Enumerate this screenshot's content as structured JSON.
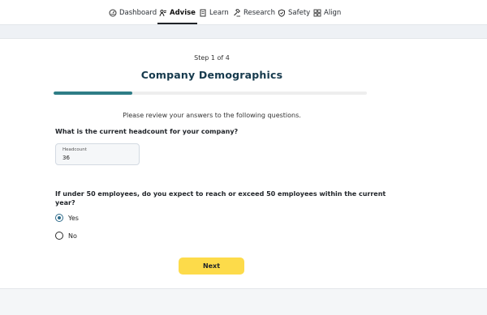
{
  "nav": {
    "items": [
      {
        "label": "Dashboard",
        "icon": "dashboard-icon",
        "active": false
      },
      {
        "label": "Advise",
        "icon": "advise-icon",
        "active": true
      },
      {
        "label": "Learn",
        "icon": "book-icon",
        "active": false
      },
      {
        "label": "Research",
        "icon": "gavel-icon",
        "active": false
      },
      {
        "label": "Safety",
        "icon": "shield-icon",
        "active": false
      },
      {
        "label": "Align",
        "icon": "grid-icon",
        "active": false
      }
    ]
  },
  "wizard": {
    "step": "Step 1 of 4",
    "title": "Company Demographics",
    "progress_fraction": 0.25,
    "intro": "Please review your answers to the following questions.",
    "question1": "What is the current headcount for your company?",
    "headcount_label": "Headcount",
    "headcount_value": "36",
    "question2": "If under 50 employees, do you expect to reach or exceed 50 employees within the current year?",
    "options": [
      {
        "label": "Yes",
        "selected": true
      },
      {
        "label": "No",
        "selected": false
      }
    ],
    "next_label": "Next"
  },
  "colors": {
    "accent": "#2e7d86",
    "title": "#163a4d",
    "button": "#fddb4a"
  }
}
